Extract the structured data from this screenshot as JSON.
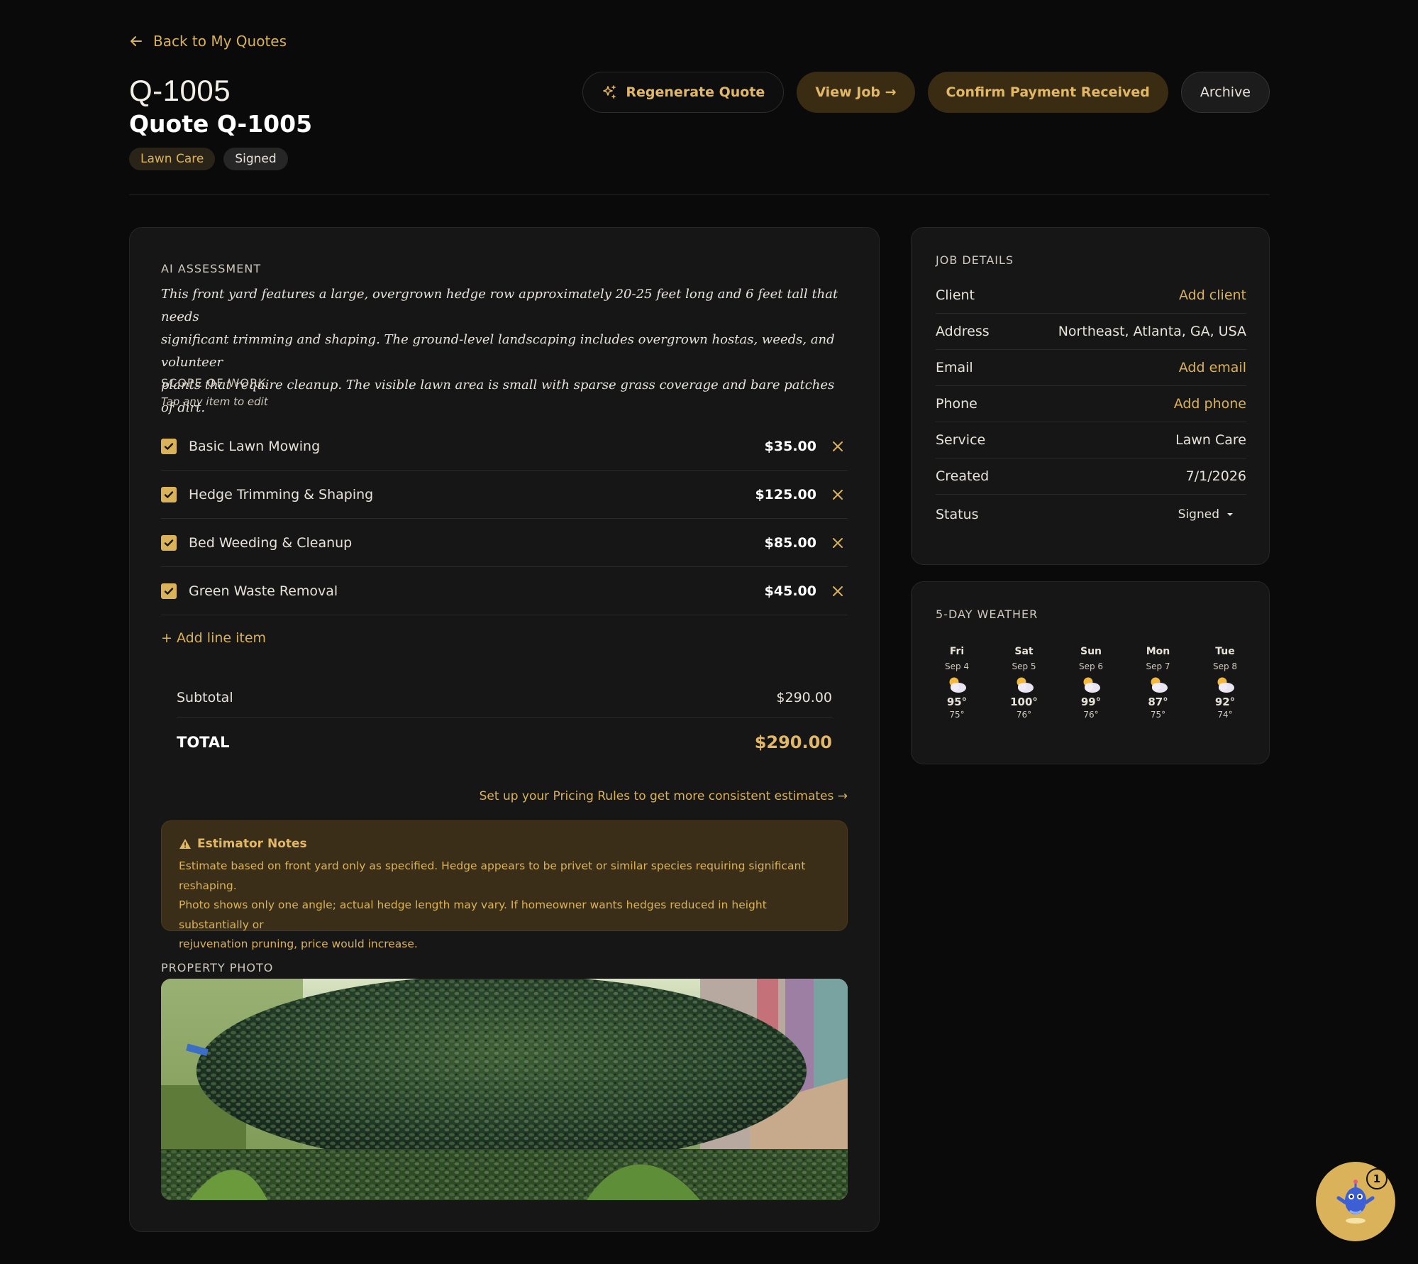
{
  "nav": {
    "back_label": "Back to My Quotes"
  },
  "quote": {
    "code": "Q-1005",
    "title": "Quote Q-1005",
    "tags": {
      "service": "Lawn Care",
      "status": "Signed"
    }
  },
  "actions": {
    "regenerate": "Regenerate Quote",
    "view_job": "View Job →",
    "confirm_payment": "Confirm Payment Received",
    "archive": "Archive"
  },
  "assessment": {
    "label": "AI ASSESSMENT",
    "lines": [
      "This front yard features a large, overgrown hedge row approximately 20-25 feet long and 6 feet tall that needs",
      "significant trimming and shaping. The ground-level landscaping includes overgrown hostas, weeds, and volunteer",
      "plants that require cleanup. The visible lawn area is small with sparse grass coverage and bare patches of dirt."
    ]
  },
  "scope": {
    "label": "SCOPE OF WORK",
    "hint": "Tap any item to edit",
    "items": [
      {
        "name": "Basic Lawn Mowing",
        "price": "$35.00",
        "checked": true
      },
      {
        "name": "Hedge Trimming & Shaping",
        "price": "$125.00",
        "checked": true
      },
      {
        "name": "Bed Weeding & Cleanup",
        "price": "$85.00",
        "checked": true
      },
      {
        "name": "Green Waste Removal",
        "price": "$45.00",
        "checked": true
      }
    ],
    "add_label": "+ Add line item"
  },
  "totals": {
    "subtotal_label": "Subtotal",
    "subtotal_value": "$290.00",
    "total_label": "TOTAL",
    "total_value": "$290.00"
  },
  "pricing_link": "Set up your Pricing Rules to get more consistent estimates →",
  "notes": {
    "title": "Estimator Notes",
    "lines": [
      "Estimate based on front yard only as specified. Hedge appears to be privet or similar species requiring significant reshaping.",
      "Photo shows only one angle; actual hedge length may vary. If homeowner wants hedges reduced in height substantially or",
      "rejuvenation pruning, price would increase."
    ]
  },
  "photo": {
    "label": "PROPERTY PHOTO"
  },
  "job_details": {
    "label": "JOB DETAILS",
    "rows": [
      {
        "label": "Client",
        "value": "Add client"
      },
      {
        "label": "Address",
        "value": "Northeast, Atlanta, GA, USA"
      },
      {
        "label": "Email",
        "value": "Add email"
      },
      {
        "label": "Phone",
        "value": "Add phone"
      },
      {
        "label": "Service",
        "value": "Lawn Care"
      },
      {
        "label": "Created",
        "value": "7/1/2026"
      },
      {
        "label": "Status",
        "value": "Signed"
      }
    ]
  },
  "weather": {
    "label": "5-DAY WEATHER",
    "icon": "partly-cloudy-icon",
    "days": [
      {
        "day": "Fri",
        "date": "Sep 4",
        "high": "95°",
        "low": "75°"
      },
      {
        "day": "Sat",
        "date": "Sep 5",
        "high": "100°",
        "low": "76°"
      },
      {
        "day": "Sun",
        "date": "Sep 6",
        "high": "99°",
        "low": "76°"
      },
      {
        "day": "Mon",
        "date": "Sep 7",
        "high": "87°",
        "low": "75°"
      },
      {
        "day": "Tue",
        "date": "Sep 8",
        "high": "92°",
        "low": "74°"
      }
    ]
  },
  "assistant": {
    "badge": "1"
  },
  "colors": {
    "accent": "#d9b25a",
    "background": "#0a0a0a",
    "card": "#161616",
    "notes_bg": "#3a2e18"
  }
}
